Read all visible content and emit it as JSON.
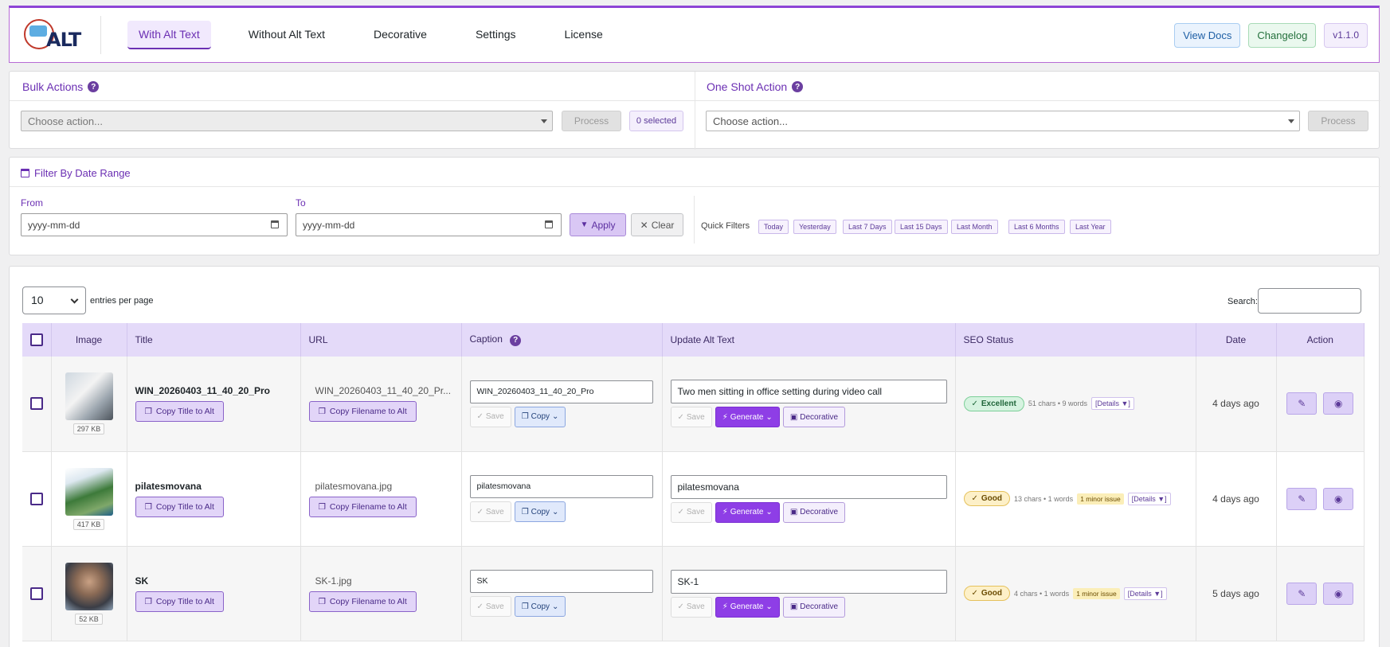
{
  "header": {
    "logo_text": "ALT",
    "tabs": [
      {
        "label": "With Alt Text",
        "active": true
      },
      {
        "label": "Without Alt Text"
      },
      {
        "label": "Decorative"
      },
      {
        "label": "Settings"
      },
      {
        "label": "License"
      }
    ],
    "view_docs": "View Docs",
    "changelog": "Changelog",
    "version": "v1.1.0"
  },
  "bulk": {
    "title": "Bulk Actions",
    "placeholder": "Choose action...",
    "process": "Process",
    "selected": "0 selected"
  },
  "oneshot": {
    "title": "One Shot Action",
    "placeholder": "Choose action...",
    "process": "Process"
  },
  "filter": {
    "title": "Filter By Date Range",
    "from_label": "From",
    "to_label": "To",
    "from_placeholder": "yyyy-mm-dd",
    "to_placeholder": "yyyy-mm-dd",
    "apply": "Apply",
    "clear": "Clear",
    "quick_label": "Quick Filters",
    "quick": [
      "Today",
      "Yesterday",
      "Last 7 Days",
      "Last 15 Days",
      "Last Month",
      "Last 6 Months",
      "Last Year"
    ]
  },
  "table": {
    "entries_value": "10",
    "entries_label": "entries per page",
    "search_label": "Search:",
    "columns": [
      "Image",
      "Title",
      "URL",
      "Caption",
      "Update Alt Text",
      "SEO Status",
      "Date",
      "Action"
    ],
    "copy_title": "Copy Title to Alt",
    "copy_filename": "Copy Filename to Alt",
    "save": "Save",
    "copy": "Copy",
    "generate": "Generate",
    "decorative": "Decorative",
    "rows": [
      {
        "size": "297 KB",
        "title": "WIN_20260403_11_40_20_Pro",
        "url": "WIN_20260403_11_40_20_Pr...",
        "caption": "WIN_20260403_11_40_20_Pro",
        "alt": "Two men sitting in office setting during video call",
        "seo_label": "Excellent",
        "seo_meta": "51 chars • 9 words",
        "issue": "",
        "details": "[Details ▼]",
        "date": "4 days ago"
      },
      {
        "size": "417 KB",
        "title": "pilatesmovana",
        "url": "pilatesmovana.jpg",
        "caption": "pilatesmovana",
        "alt": "pilatesmovana",
        "seo_label": "Good",
        "seo_meta": "13 chars • 1 words",
        "issue": "1 minor issue",
        "details": "[Details ▼]",
        "date": "4 days ago"
      },
      {
        "size": "52 KB",
        "title": "SK",
        "url": "SK-1.jpg",
        "caption": "SK",
        "alt": "SK-1",
        "seo_label": "Good",
        "seo_meta": "4 chars • 1 words",
        "issue": "1 minor issue",
        "details": "[Details ▼]",
        "date": "5 days ago"
      }
    ]
  }
}
